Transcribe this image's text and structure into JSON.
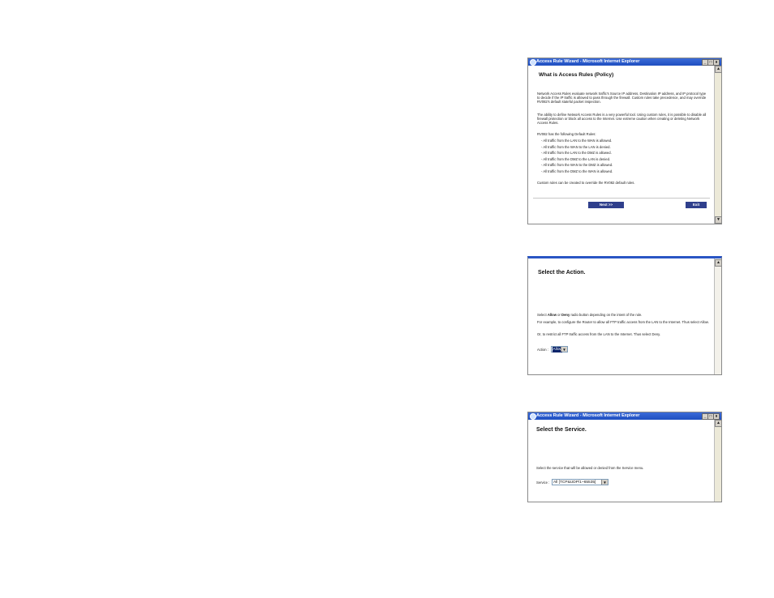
{
  "window1": {
    "title": "Access Rule Wizard - Microsoft Internet Explorer",
    "controls": [
      "_",
      "□",
      "x"
    ],
    "heading": "What is Access Rules (Policy)",
    "para1": "Network Access Rules evaluate network traffic's Source IP address, Destination IP address, and IP protocol type to decide if the IP traffic is allowed to pass through the firewall. Custom rules take precedence, and may override RV082's default stateful packet inspection.",
    "para2": "The ability to define Network Access Rules is a very powerful tool. Using custom rules, it is possible to disable all firewall protection or block all access to the Internet. Use extreme caution when creating or deleting Network Access Rules.",
    "list_intro": "RV082 has the following Default Rules:",
    "rules": [
      "- All traffic from the LAN to the WAN is allowed.",
      "- All traffic from the WAN to the LAN is denied.",
      "- All traffic from the LAN to the DMZ is allowed.",
      "- All traffic from the DMZ to the LAN is denied.",
      "- All traffic from the WAN to the DMZ is allowed.",
      "- All traffic from the DMZ to the WAN is allowed."
    ],
    "footer": "Custom rules can be created to override the RV082 default rules.",
    "next_label": "Next >>",
    "exit_label": "Exit"
  },
  "window2": {
    "heading": "Select the Action.",
    "line1_pre": "Select ",
    "line1_allow": "Allow",
    "line1_mid": " or ",
    "line1_deny": "Deny",
    "line1_post": " radio button depending on the intent of the rule.",
    "line2": "For example, to configure the Router to allow all FTP traffic access from the LAN to the Internet. Thus select Allow.",
    "line3": "Or, to restrict all FTP traffic access from the LAN to the Internet. Thus select Deny.",
    "action_label": "Action :",
    "action_value": "Allow"
  },
  "window3": {
    "title": "Access Rule Wizard - Microsoft Internet Explorer",
    "controls": [
      "_",
      "□",
      "x"
    ],
    "heading": "Select the Service.",
    "instruction": "Select the service that will be allowed or denied from the Service menu.",
    "service_label": "Service :",
    "service_value": "All [TCP&UDP/1~65535]"
  }
}
